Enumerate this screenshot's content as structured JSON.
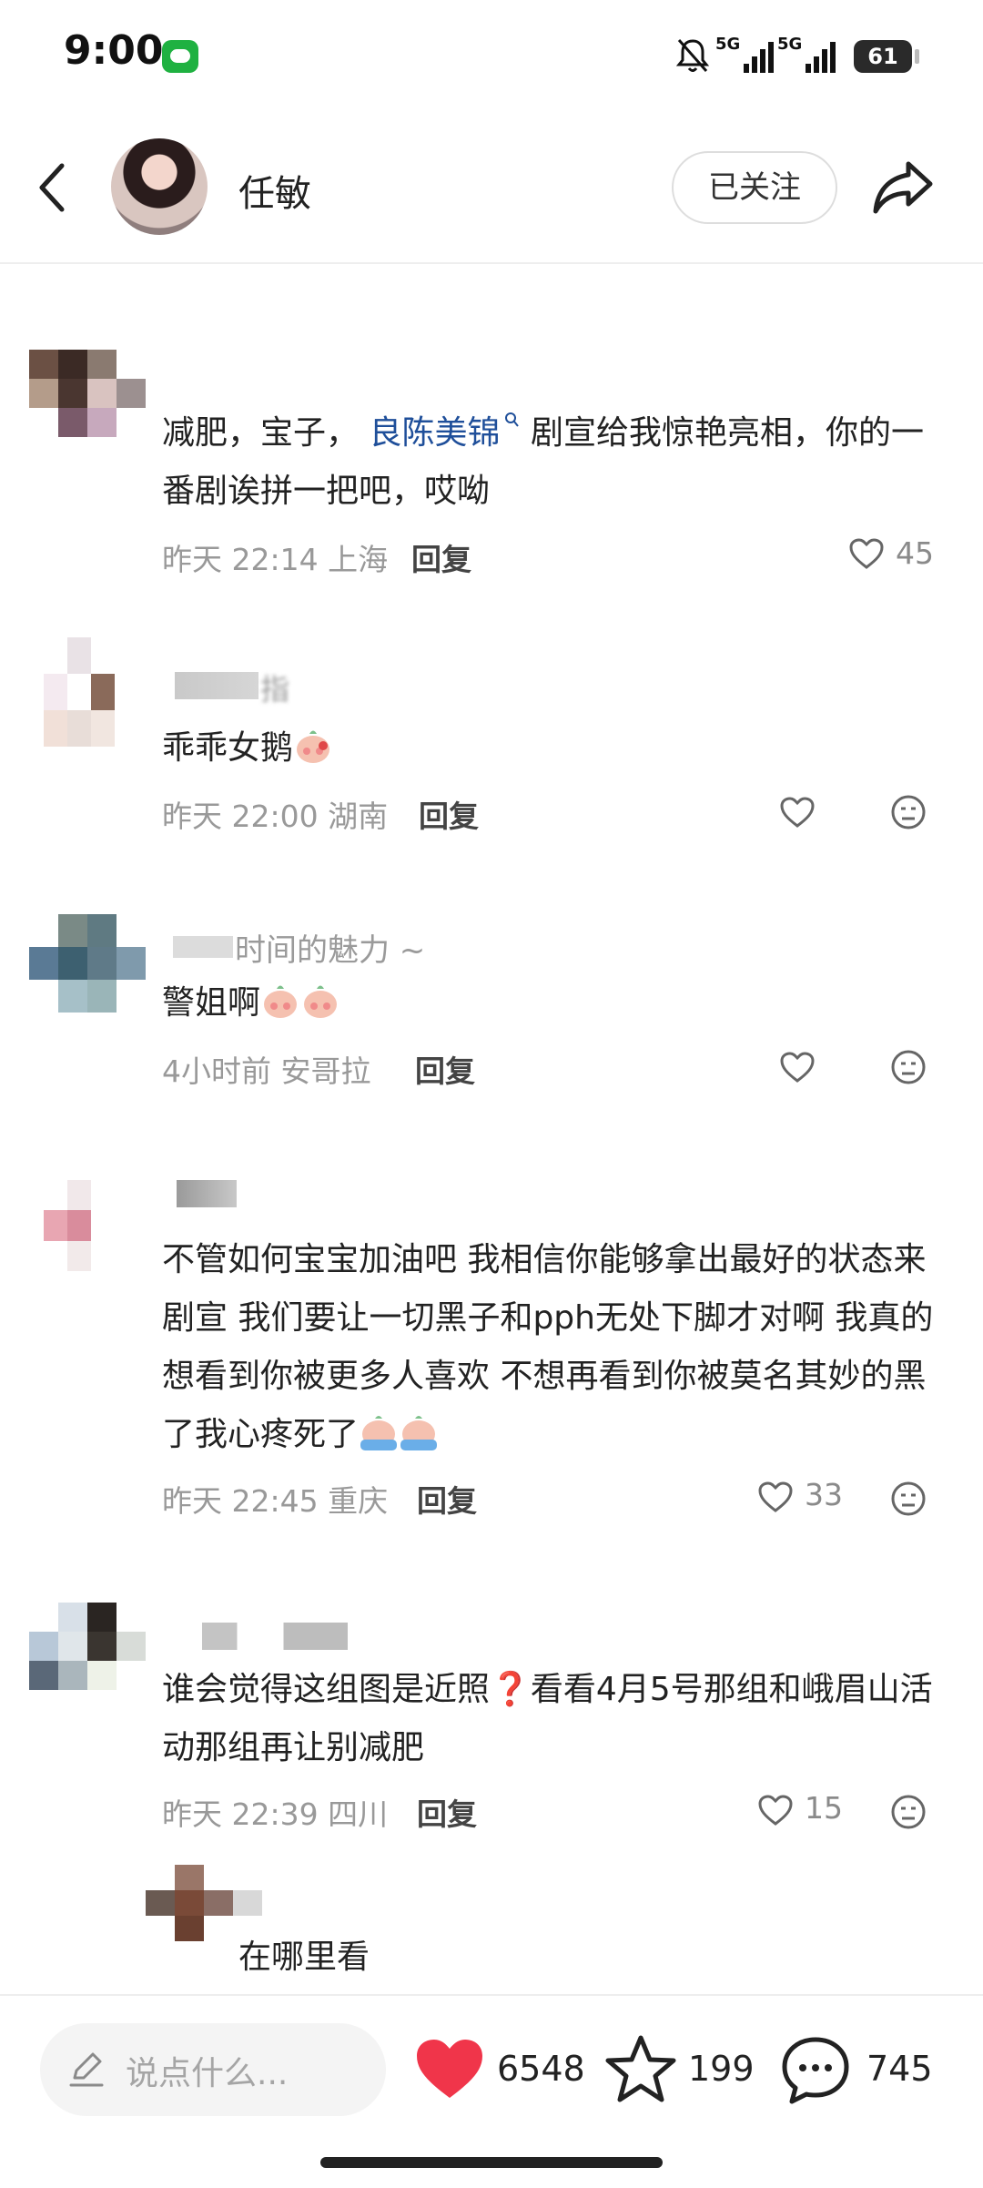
{
  "status_bar": {
    "time": "9:00",
    "net1": "5G",
    "net2": "5G",
    "battery": "61"
  },
  "header": {
    "title": "任敏",
    "follow_label": "已关注"
  },
  "comments": [
    {
      "text_pre": "减肥，宝子，",
      "link": "良陈美锦",
      "text_post": "剧宣给我惊艳亮相，你的一番剧诶拼一把吧，哎呦",
      "time": "昨天 22:14 上海",
      "reply_label": "回复",
      "likes": "45"
    },
    {
      "name": "指",
      "text": "乖乖女鹅",
      "time": "昨天 22:00 湖南",
      "reply_label": "回复"
    },
    {
      "name": "时间的魅力 ~",
      "text": "警姐啊",
      "time": "4小时前 安哥拉",
      "reply_label": "回复"
    },
    {
      "text": "不管如何宝宝加油吧 我相信你能够拿出最好的状态来剧宣 我们要让一切黑子和pph无处下脚才对啊 我真的想看到你被更多人喜欢 不想再看到你被莫名其妙的黑了我心疼死了",
      "time": "昨天 22:45 重庆",
      "reply_label": "回复",
      "likes": "33"
    },
    {
      "text": "谁会觉得这组图是近照❓看看4月5号那组和峨眉山活动那组再让别减肥",
      "time": "昨天 22:39 四川",
      "reply_label": "回复",
      "likes": "15"
    },
    {
      "text": "在哪里看"
    }
  ],
  "bottom_bar": {
    "input_placeholder": "说点什么...",
    "like_count": "6548",
    "fav_count": "199",
    "comment_count": "745"
  },
  "colors": {
    "like_red": "#f0354a",
    "link_blue": "#1f4f9a"
  },
  "icons": [
    "back-icon",
    "share-icon",
    "heart-icon",
    "face-icon",
    "pen-icon",
    "star-icon",
    "comment-icon",
    "bell-off-icon"
  ]
}
